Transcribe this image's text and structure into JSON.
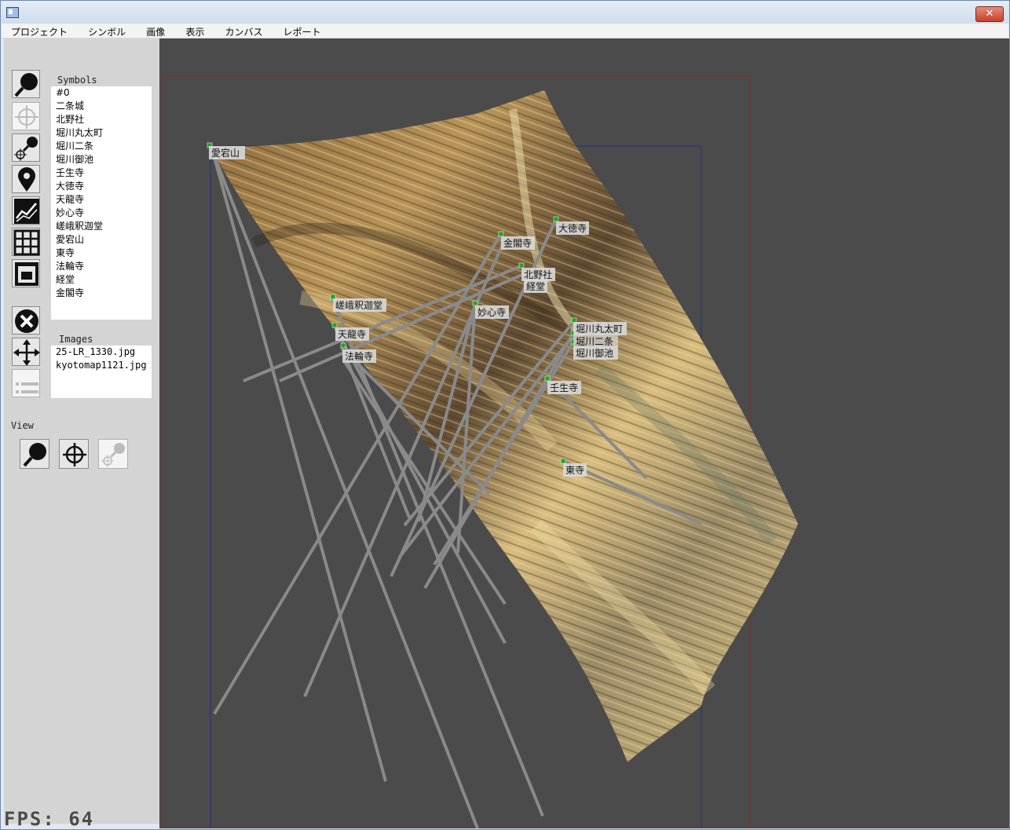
{
  "window": {
    "close_glyph": "✕"
  },
  "menu": [
    "プロジェクト",
    "シンボル",
    "画像",
    "表示",
    "カンバス",
    "レポート"
  ],
  "tools": [
    {
      "name": "zoom-tool-icon",
      "selected": false
    },
    {
      "name": "crosshair-tool-icon",
      "selected": true
    },
    {
      "name": "zoom-crosshair-tool-icon",
      "selected": false
    },
    {
      "name": "map-pin-tool-icon",
      "selected": false
    },
    {
      "name": "chart-tool-icon",
      "selected": false
    },
    {
      "name": "grid-tool-icon",
      "selected": false
    },
    {
      "name": "layout-tool-icon",
      "selected": false
    },
    {
      "name": "delete-tool-icon",
      "selected": false
    },
    {
      "name": "move-tool-icon",
      "selected": false
    },
    {
      "name": "list-tool-icon",
      "selected": true
    }
  ],
  "symbols": {
    "label": "Symbols",
    "items": [
      "#0",
      "二条城",
      "北野社",
      "堀川丸太町",
      "堀川二条",
      "堀川御池",
      "壬生寺",
      "大徳寺",
      "天龍寺",
      "妙心寺",
      "嵯峨釈迦堂",
      "愛宕山",
      "東寺",
      "法輪寺",
      "経堂",
      "金閣寺"
    ]
  },
  "images": {
    "label": "Images",
    "items": [
      "25-LR_1330.jpg",
      "kyotomap1121.jpg"
    ]
  },
  "view": {
    "label": "View"
  },
  "canvas_labels": [
    {
      "text": "愛宕山"
    },
    {
      "text": "金閣寺"
    },
    {
      "text": "大徳寺"
    },
    {
      "text": "北野社"
    },
    {
      "text": "経堂"
    },
    {
      "text": "嵯峨釈迦堂"
    },
    {
      "text": "妙心寺"
    },
    {
      "text": "堀川丸太町"
    },
    {
      "text": "天龍寺"
    },
    {
      "text": "堀川二条"
    },
    {
      "text": "堀川御池"
    },
    {
      "text": "法輪寺"
    },
    {
      "text": "壬生寺"
    },
    {
      "text": "東寺"
    }
  ],
  "fps": "FPS: 64",
  "colors": {
    "canvas_bg": "#4b4b4b",
    "marker": "#1fa51f",
    "ray": "#8a8a8a",
    "frame_red": "#8b2a2a",
    "frame_blue": "#2a2a8a"
  }
}
